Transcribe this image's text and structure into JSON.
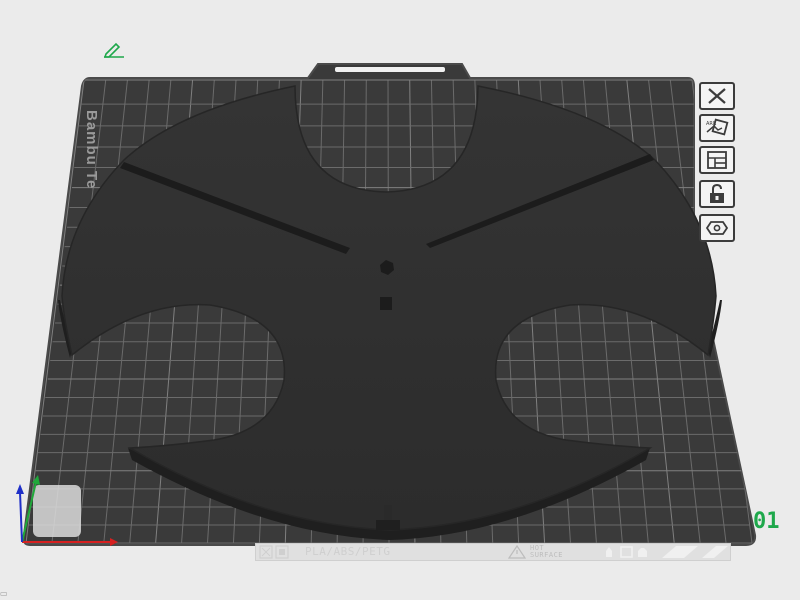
{
  "plate": {
    "brand_label": "Bambu Te",
    "plate_number": "01",
    "material_label": "PLA/ABS/PETG",
    "hot_surface_line1": "HOT",
    "hot_surface_line2": "SURFACE"
  },
  "toolbar": {
    "buttons": [
      {
        "name": "remove-plate",
        "icon": "close-icon"
      },
      {
        "name": "auto-arrange",
        "icon": "arrange-icon"
      },
      {
        "name": "plate-settings",
        "icon": "layout-icon"
      },
      {
        "name": "lock-plate",
        "icon": "lock-icon"
      },
      {
        "name": "plate-type",
        "icon": "hexagon-icon"
      }
    ]
  },
  "colors": {
    "background": "#ebebeb",
    "plate": "#3b3b3b",
    "grid": "#6a6a6a",
    "model": "#2f2f2f",
    "plate_number": "#1ea84b",
    "axis_x": "#d62020",
    "axis_y": "#1fa83a",
    "axis_z": "#1f2fc8"
  }
}
